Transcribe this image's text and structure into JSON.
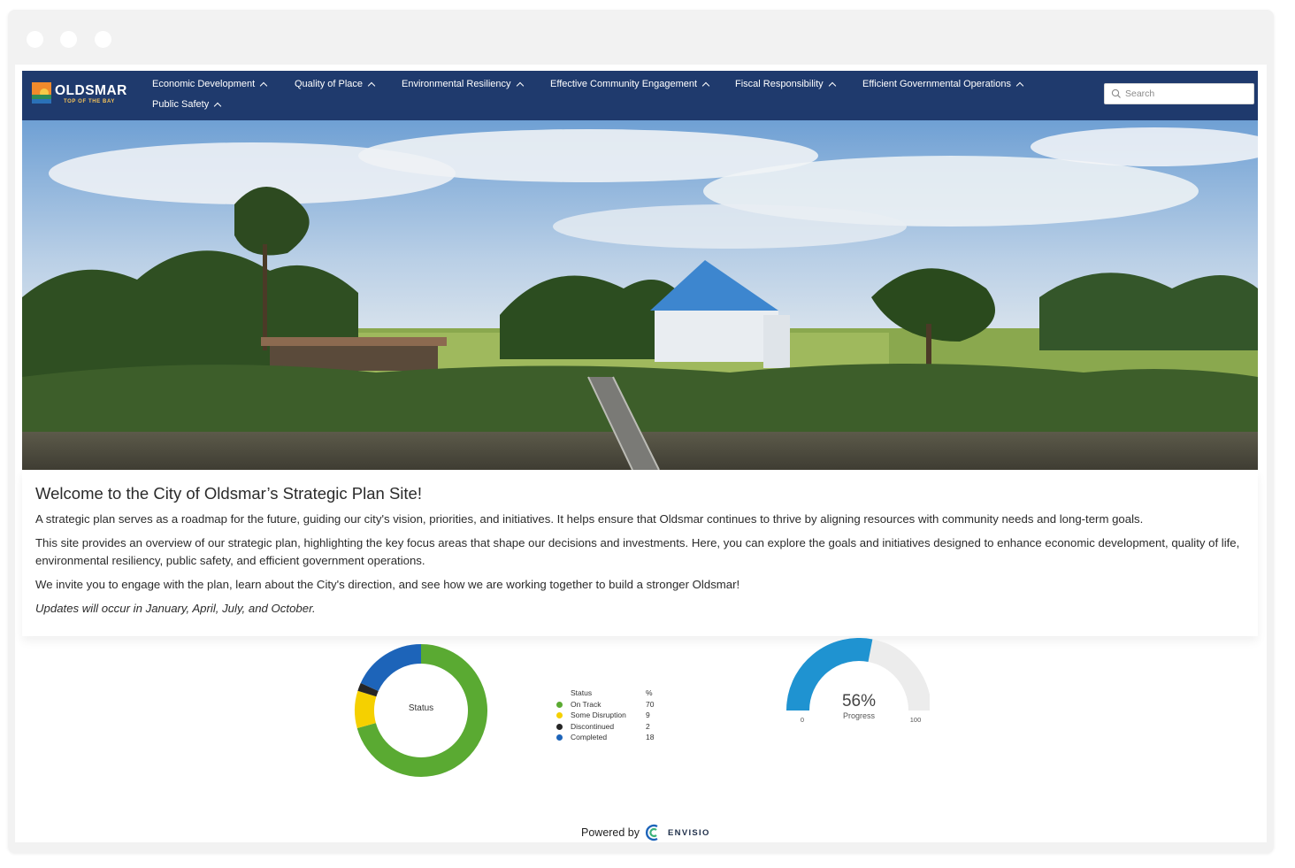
{
  "brand": {
    "name": "OLDSMAR",
    "tagline": "TOP OF THE BAY"
  },
  "nav": {
    "items": [
      {
        "label": "Economic Development"
      },
      {
        "label": "Quality of Place"
      },
      {
        "label": "Environmental Resiliency"
      },
      {
        "label": "Effective Community Engagement"
      },
      {
        "label": "Fiscal Responsibility"
      },
      {
        "label": "Efficient Governmental Operations"
      },
      {
        "label": "Public Safety"
      }
    ]
  },
  "search": {
    "placeholder": "Search"
  },
  "intro": {
    "title": "Welcome to the City of Oldsmar’s Strategic Plan Site!",
    "p1": "A strategic plan serves as a roadmap for the future, guiding our city's vision, priorities, and initiatives. It helps ensure that Oldsmar continues to thrive by aligning resources with community needs and long-term goals.",
    "p2": "This site provides an overview of our strategic plan, highlighting the key focus areas that shape our decisions and investments. Here, you can explore the goals and initiatives designed to enhance economic development, quality of life, environmental resiliency, public safety, and efficient government operations.",
    "p3": "We invite you to engage with the plan, learn about the City's direction, and see how we are working together to build a stronger Oldsmar!",
    "p4": "Updates will occur in January, April, July, and October."
  },
  "status_chart": {
    "center_label": "Status",
    "legend_header": {
      "status": "Status",
      "pct": "%"
    },
    "items": [
      {
        "label": "On Track",
        "value": 70,
        "color": "#5aaa32"
      },
      {
        "label": "Some Disruption",
        "value": 9,
        "color": "#f5d000"
      },
      {
        "label": "Discontinued",
        "value": 2,
        "color": "#262626"
      },
      {
        "label": "Completed",
        "value": 18,
        "color": "#1d64b9"
      }
    ]
  },
  "progress_gauge": {
    "value": 56,
    "value_text": "56%",
    "label": "Progress",
    "min": "0",
    "max": "100",
    "fill_color": "#1f93d1",
    "track_color": "#ececec"
  },
  "footer": {
    "powered_by": "Powered by",
    "vendor": "ENVISIO"
  }
}
